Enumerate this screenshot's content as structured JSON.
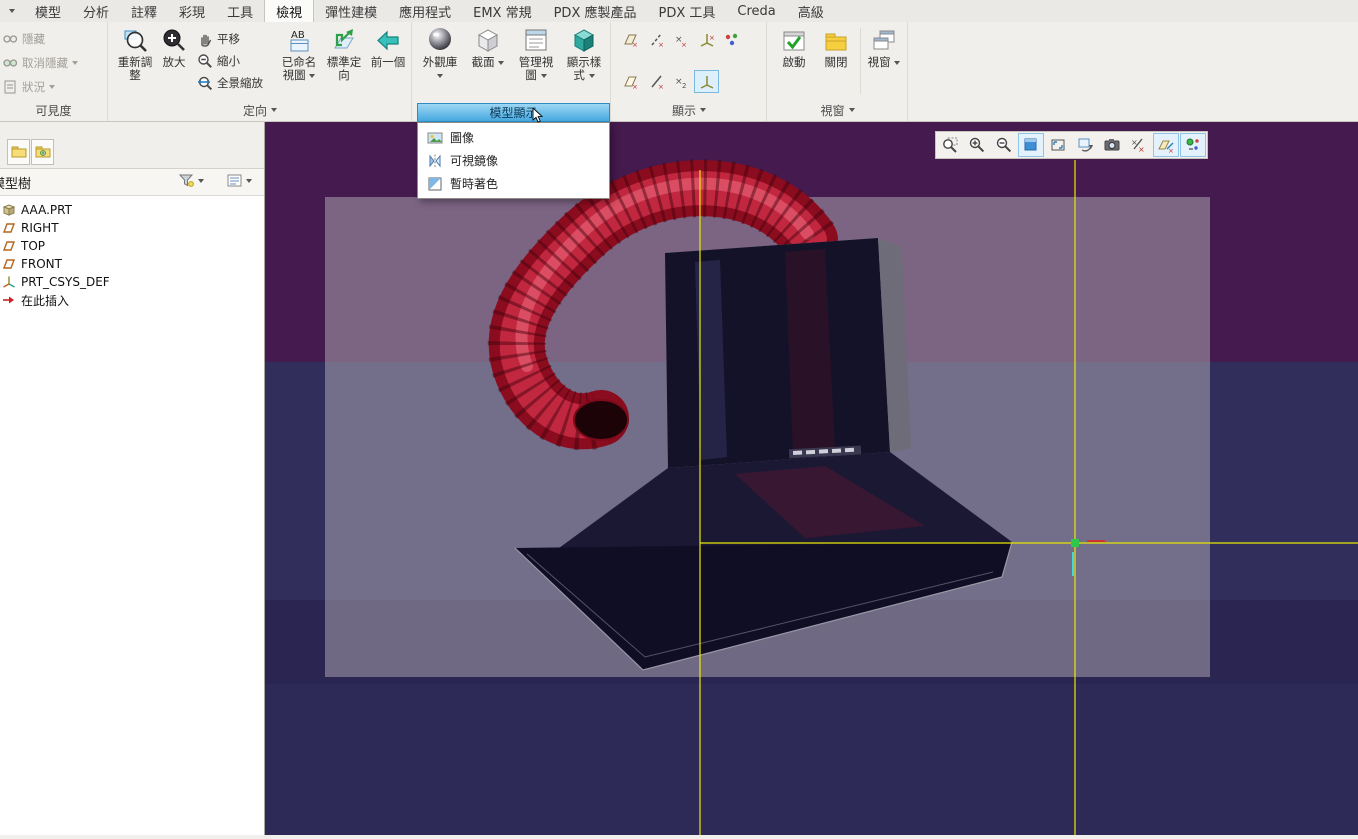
{
  "tabs": [
    "模型",
    "分析",
    "註釋",
    "彩現",
    "工具",
    "檢視",
    "彈性建模",
    "應用程式",
    "EMX 常規",
    "PDX 應製產品",
    "PDX 工具",
    "Creda",
    "高級"
  ],
  "active_tab": "檢視",
  "ribbon": {
    "visibility": {
      "label": "可見度",
      "items": [
        {
          "label": "隱藏"
        },
        {
          "label": "取消隱藏"
        },
        {
          "label": "狀況"
        }
      ]
    },
    "orientation": {
      "label": "定向",
      "refit": "重新調整",
      "zoom_in": "放大",
      "pan": "平移",
      "zoom_out": "縮小",
      "zoom_all": "全景縮放",
      "named_views": "已命名視圖",
      "standard_orient": "標準定向",
      "previous": "前一個"
    },
    "model_display": {
      "label": "模型顯示",
      "appearance": "外觀庫",
      "section": "截面",
      "manage_views": "管理視圖",
      "display_style": "顯示樣式"
    },
    "show": {
      "label": "顯示"
    },
    "window": {
      "label": "視窗",
      "activate": "啟動",
      "close": "關閉",
      "windows": "視窗"
    }
  },
  "dropdown": {
    "title": "模型顯示",
    "items": [
      {
        "label": "圖像",
        "icon": "image-icon"
      },
      {
        "label": "可視鏡像",
        "icon": "mirror-icon"
      },
      {
        "label": "暫時著色",
        "icon": "temp-shade-icon"
      }
    ]
  },
  "model_tree": {
    "title": "模型樹",
    "items": [
      {
        "label": "AAA.PRT",
        "icon": "part-icon"
      },
      {
        "label": "RIGHT",
        "icon": "datum-plane-icon"
      },
      {
        "label": "TOP",
        "icon": "datum-plane-icon"
      },
      {
        "label": "FRONT",
        "icon": "datum-plane-icon"
      },
      {
        "label": "PRT_CSYS_DEF",
        "icon": "csys-icon"
      },
      {
        "label": "在此插入",
        "icon": "insert-here-icon"
      }
    ]
  },
  "graphics_toolbar": {
    "buttons": [
      "zoom-region-icon",
      "zoom-in-icon",
      "zoom-out-icon",
      "repaint-icon",
      "refit-icon",
      "reorient-icon",
      "snapshot-icon",
      "saved-views-icon",
      "datum-display-filters-icon",
      "display-filters-icon"
    ]
  },
  "colors": {
    "highlight_blue": "#45a8e0",
    "bg_purple": "#451a4e",
    "bg_navy": "#322e5c",
    "overlay_gray": "#b3aeb8",
    "datum_yellow": "#e8e800",
    "duct_red": "#a3122a",
    "select_green": "#2ec84a"
  }
}
